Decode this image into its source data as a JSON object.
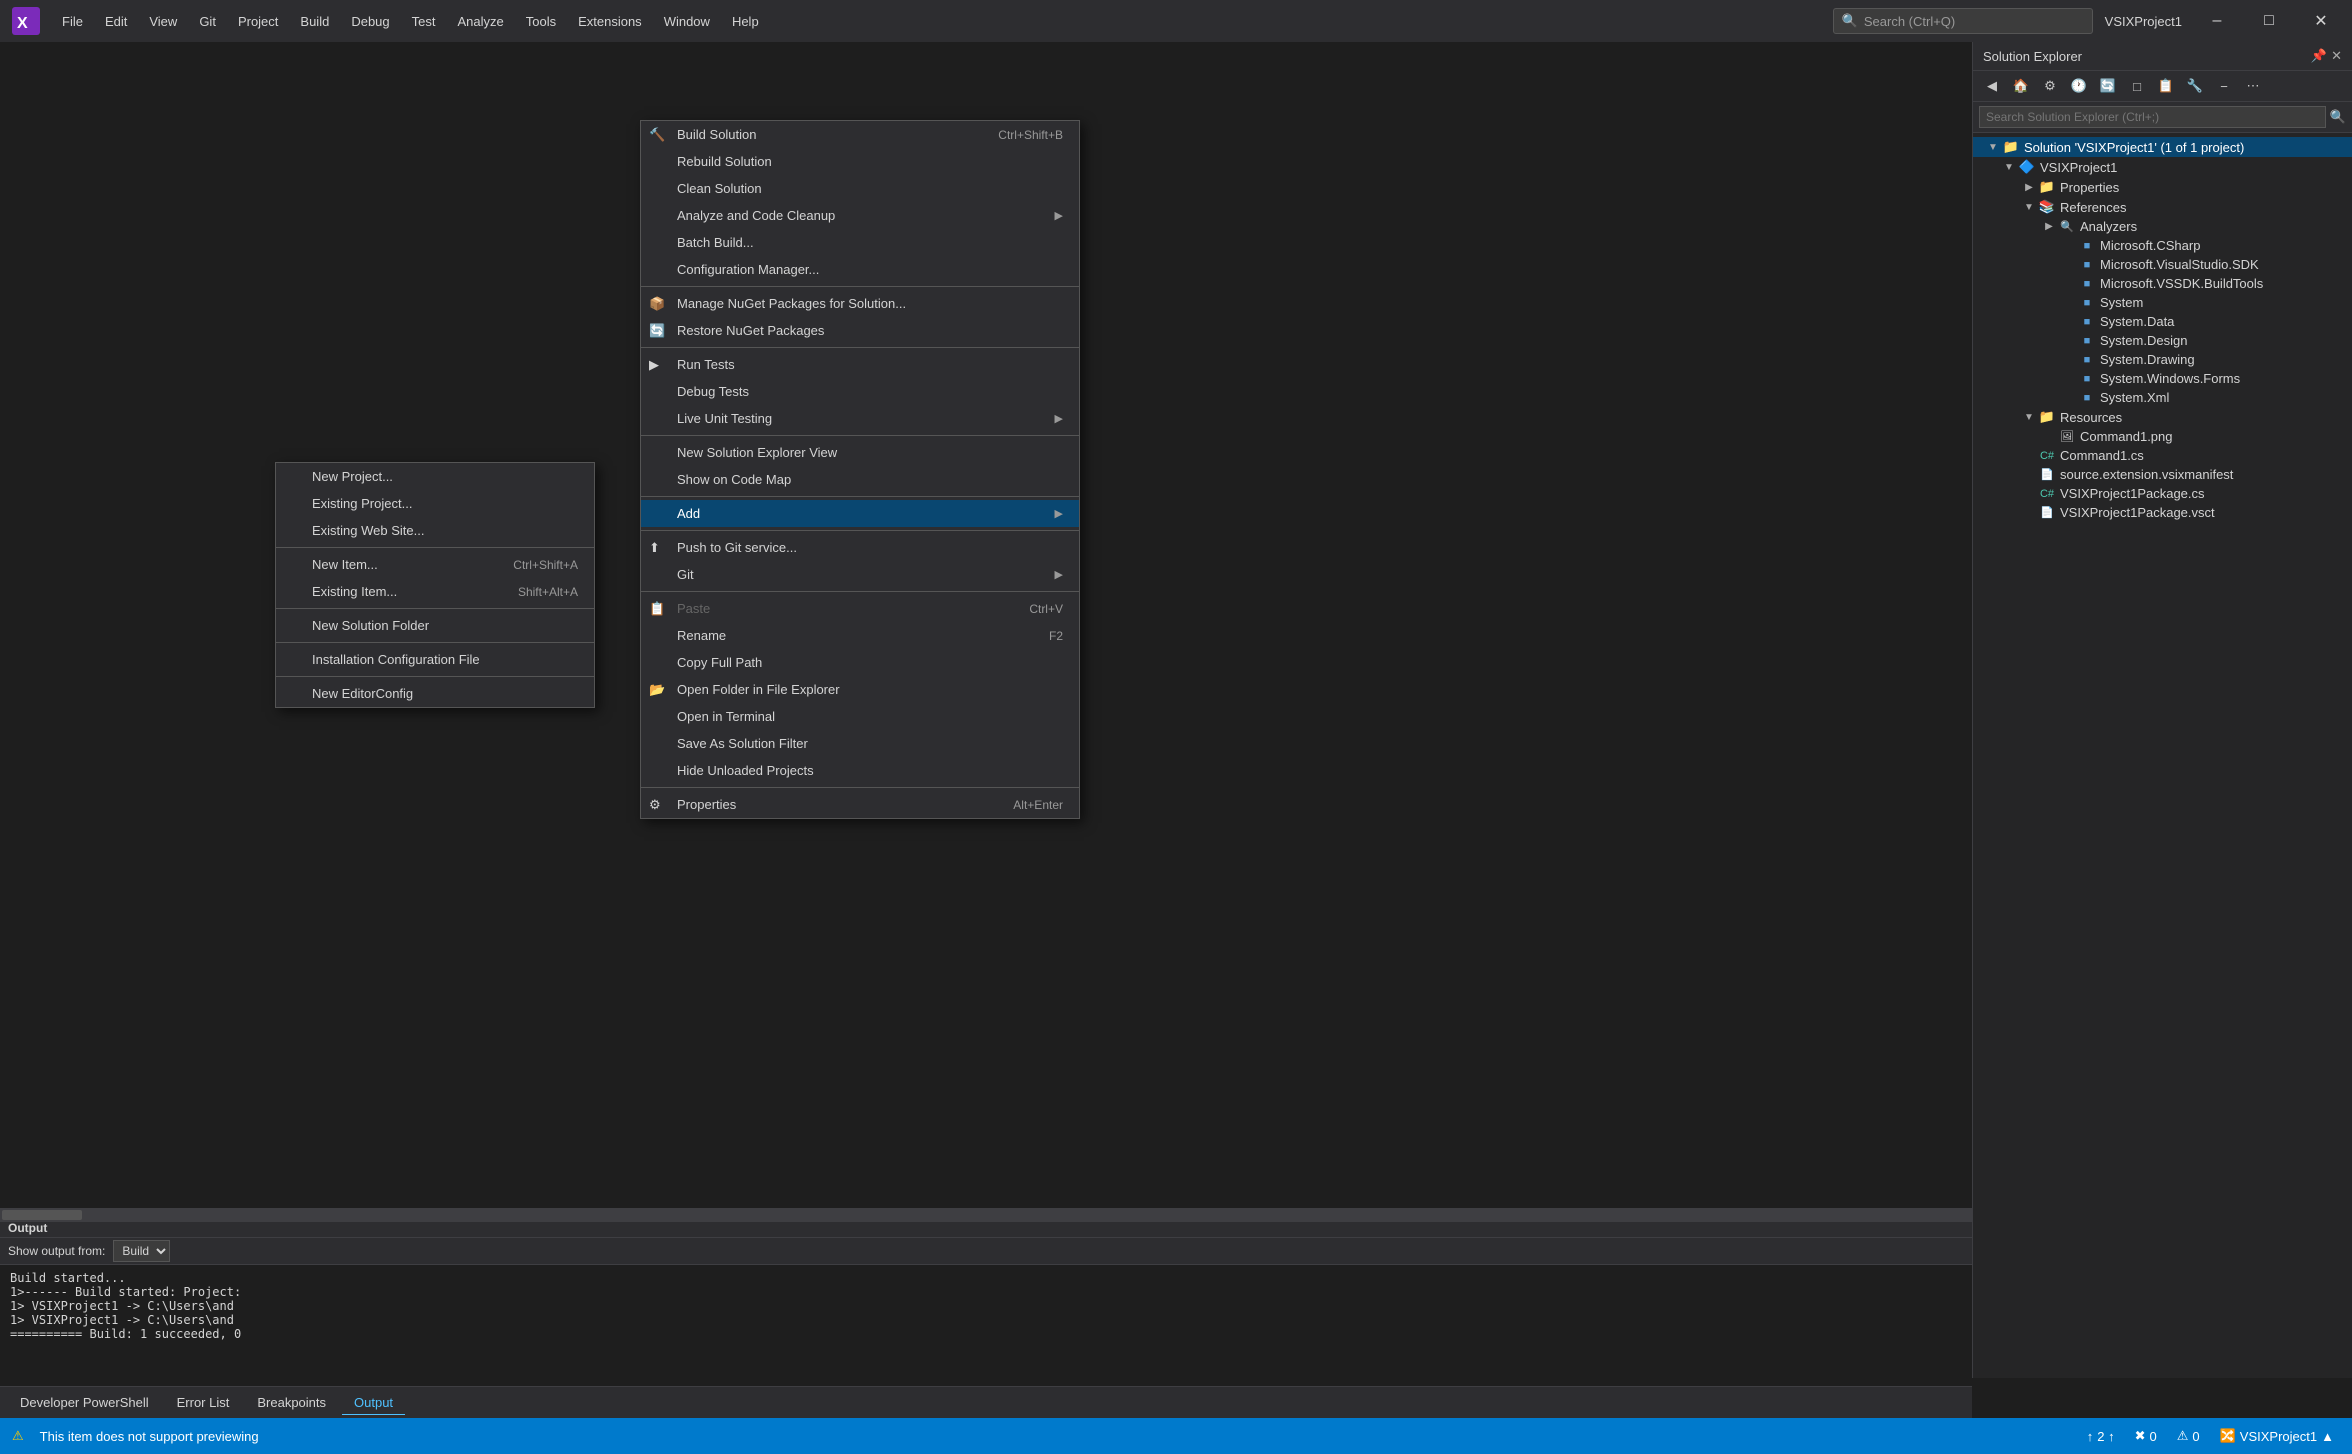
{
  "titleBar": {
    "logo": "VS",
    "menus": [
      "File",
      "Edit",
      "View",
      "Git",
      "Project",
      "Build",
      "Debug",
      "Test",
      "Analyze",
      "Tools",
      "Extensions",
      "Window",
      "Help"
    ],
    "searchPlaceholder": "Search (Ctrl+Q)",
    "title": "VSIXProject1",
    "minimizeLabel": "–",
    "maximizeLabel": "□",
    "closeLabel": "✕"
  },
  "solutionExplorer": {
    "title": "Solution Explorer",
    "searchPlaceholder": "Search Solution Explorer (Ctrl+;)",
    "tree": {
      "solutionLabel": "Solution 'VSIXProject1' (1 of 1 project)",
      "projectLabel": "VSIXProject1",
      "items": [
        {
          "label": "Properties",
          "indent": 2,
          "icon": "📁",
          "expand": "▶"
        },
        {
          "label": "References",
          "indent": 2,
          "icon": "📚",
          "expand": "▶"
        },
        {
          "label": "Analyzers",
          "indent": 3,
          "icon": "🔍",
          "expand": "▶"
        },
        {
          "label": "Microsoft.CSharp",
          "indent": 4,
          "icon": "■"
        },
        {
          "label": "Microsoft.VisualStudio.SDK",
          "indent": 4,
          "icon": "■"
        },
        {
          "label": "Microsoft.VSSDK.BuildTools",
          "indent": 4,
          "icon": "■"
        },
        {
          "label": "System",
          "indent": 4,
          "icon": "■"
        },
        {
          "label": "System.Data",
          "indent": 4,
          "icon": "■"
        },
        {
          "label": "System.Design",
          "indent": 4,
          "icon": "■"
        },
        {
          "label": "System.Drawing",
          "indent": 4,
          "icon": "■"
        },
        {
          "label": "System.Windows.Forms",
          "indent": 4,
          "icon": "■"
        },
        {
          "label": "System.Xml",
          "indent": 4,
          "icon": "■"
        },
        {
          "label": "Resources",
          "indent": 2,
          "icon": "📁",
          "expand": "▼"
        },
        {
          "label": "Command1.png",
          "indent": 3,
          "icon": "🖼"
        },
        {
          "label": "Command1.cs",
          "indent": 2,
          "icon": "📄"
        },
        {
          "label": "source.extension.vsixmanifest",
          "indent": 2,
          "icon": "📄"
        },
        {
          "label": "VSIXProject1Package.cs",
          "indent": 2,
          "icon": "📄"
        },
        {
          "label": "VSIXProject1Package.vsct",
          "indent": 2,
          "icon": "📄"
        }
      ]
    }
  },
  "buildMenu": {
    "items": [
      {
        "label": "Build Solution",
        "shortcut": "Ctrl+Shift+B",
        "icon": "🔨"
      },
      {
        "label": "Rebuild Solution",
        "shortcut": "",
        "icon": ""
      },
      {
        "label": "Clean Solution",
        "shortcut": "",
        "icon": ""
      },
      {
        "label": "Analyze and Code Cleanup",
        "shortcut": "",
        "icon": "",
        "hasArrow": true
      },
      {
        "label": "Batch Build...",
        "shortcut": "",
        "icon": ""
      },
      {
        "label": "Configuration Manager...",
        "shortcut": "",
        "icon": ""
      },
      {
        "separator": true
      },
      {
        "label": "Manage NuGet Packages for Solution...",
        "shortcut": "",
        "icon": "📦"
      },
      {
        "label": "Restore NuGet Packages",
        "shortcut": "",
        "icon": "🔄"
      },
      {
        "separator": true
      },
      {
        "label": "Run Tests",
        "shortcut": "",
        "icon": "▶"
      },
      {
        "label": "Debug Tests",
        "shortcut": "",
        "icon": ""
      },
      {
        "label": "Live Unit Testing",
        "shortcut": "",
        "icon": "",
        "hasArrow": true
      },
      {
        "separator": true
      },
      {
        "label": "New Solution Explorer View",
        "shortcut": "",
        "icon": ""
      },
      {
        "label": "Show on Code Map",
        "shortcut": "",
        "icon": ""
      },
      {
        "separator": true
      },
      {
        "label": "Add",
        "shortcut": "",
        "icon": "",
        "hasArrow": true,
        "activeHover": true
      },
      {
        "separator": true
      },
      {
        "label": "Push to Git service...",
        "shortcut": "",
        "icon": "⬆"
      },
      {
        "label": "Git",
        "shortcut": "",
        "icon": "",
        "hasArrow": true
      },
      {
        "separator": true
      },
      {
        "label": "Paste",
        "shortcut": "Ctrl+V",
        "icon": "📋",
        "disabled": true
      },
      {
        "label": "Rename",
        "shortcut": "F2",
        "icon": ""
      },
      {
        "label": "Copy Full Path",
        "shortcut": "",
        "icon": ""
      },
      {
        "label": "Open Folder in File Explorer",
        "shortcut": "",
        "icon": "🔄"
      },
      {
        "label": "Open in Terminal",
        "shortcut": "",
        "icon": ""
      },
      {
        "label": "Save As Solution Filter",
        "shortcut": "",
        "icon": ""
      },
      {
        "label": "Hide Unloaded Projects",
        "shortcut": "",
        "icon": ""
      },
      {
        "separator": true
      },
      {
        "label": "Properties",
        "shortcut": "Alt+Enter",
        "icon": "⚙"
      }
    ]
  },
  "addSubMenu": {
    "items": [
      {
        "label": "New Project...",
        "shortcut": "",
        "icon": ""
      },
      {
        "label": "Existing Project...",
        "shortcut": "",
        "icon": ""
      },
      {
        "label": "Existing Web Site...",
        "shortcut": "",
        "icon": ""
      },
      {
        "separator": true
      },
      {
        "label": "New Item...",
        "shortcut": "Ctrl+Shift+A",
        "icon": ""
      },
      {
        "label": "Existing Item...",
        "shortcut": "Shift+Alt+A",
        "icon": ""
      },
      {
        "separator": true
      },
      {
        "label": "New Solution Folder",
        "shortcut": "",
        "icon": ""
      },
      {
        "separator": true
      },
      {
        "label": "Installation Configuration File",
        "shortcut": "",
        "icon": ""
      },
      {
        "separator": true
      },
      {
        "label": "New EditorConfig",
        "shortcut": "",
        "icon": ""
      }
    ]
  },
  "outputPanel": {
    "title": "Output",
    "showLabel": "Show output from:",
    "source": "Build",
    "lines": [
      "Build started...",
      "1>------ Build started: Project:",
      "1>   VSIXProject1 -> C:\\Users\\and",
      "1>   VSIXProject1 -> C:\\Users\\and",
      "========== Build: 1 succeeded, 0"
    ]
  },
  "bottomTabs": [
    {
      "label": "Developer PowerShell"
    },
    {
      "label": "Error List"
    },
    {
      "label": "Breakpoints"
    },
    {
      "label": "Output",
      "active": true
    }
  ],
  "statusBar": {
    "message": "This item does not support previewing",
    "warningIcon": "⚠",
    "lineCol": "2  ↑",
    "errors": "0",
    "warnings": "0",
    "branchLabel": "VSIXProject1",
    "chevron": "▲"
  }
}
